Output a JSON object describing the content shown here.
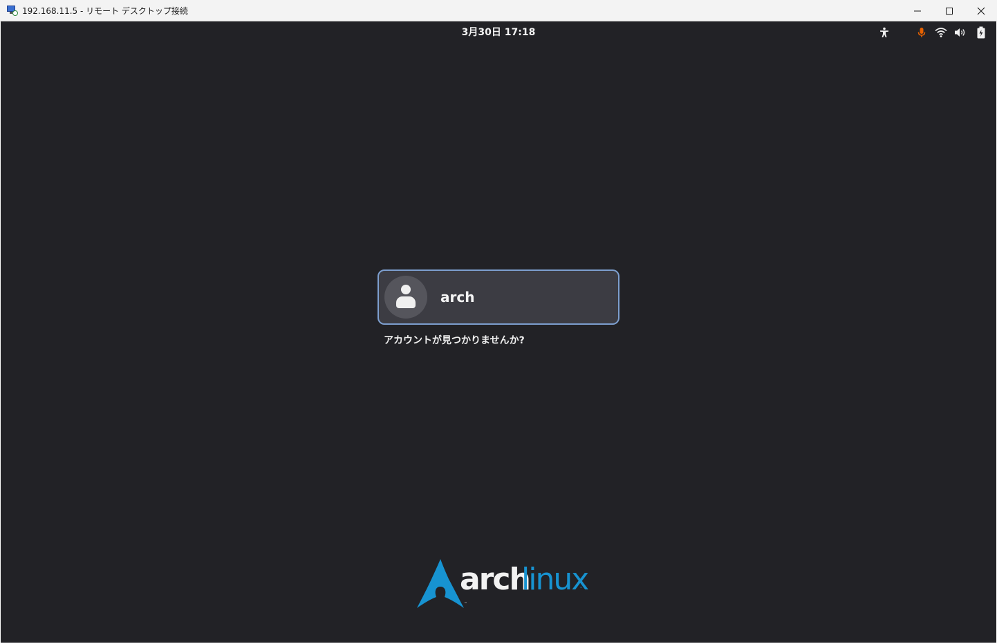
{
  "window": {
    "title": "192.168.11.5 - リモート デスクトップ接続",
    "controls": [
      "minimize-icon",
      "maximize-icon",
      "close-icon"
    ]
  },
  "topbar": {
    "clock": "3月30日  17:18",
    "tray_icons": [
      "accessibility-icon",
      "microphone-icon",
      "wifi-icon",
      "volume-icon",
      "battery-icon"
    ],
    "mic_color": "#e66100"
  },
  "login": {
    "username": "arch",
    "not_listed": "アカウントが見つかりませんか?"
  },
  "logo": {
    "word_arch": "arch",
    "word_linux": "linux",
    "trademark": "™",
    "brand_color": "#1793d1"
  },
  "colors": {
    "background": "#222226",
    "card_border": "#7d9fcf",
    "card_fill": "#3c3c43"
  }
}
